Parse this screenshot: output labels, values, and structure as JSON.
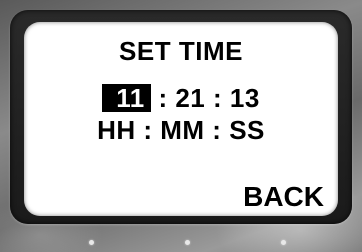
{
  "screen": {
    "title": "SET TIME",
    "time": {
      "hours": "11",
      "sep1": " : ",
      "minutes": "21",
      "sep2": " : ",
      "seconds": "13"
    },
    "units_label": "HH : MM : SS",
    "back_label": "BACK",
    "selected_field": "hours"
  },
  "hardware_buttons": [
    "left",
    "center",
    "right"
  ],
  "colors": {
    "screen_bg": "#ffffff",
    "text": "#000000",
    "highlight_bg": "#000000",
    "highlight_text": "#ffffff",
    "bezel": "#1f1f1f"
  }
}
